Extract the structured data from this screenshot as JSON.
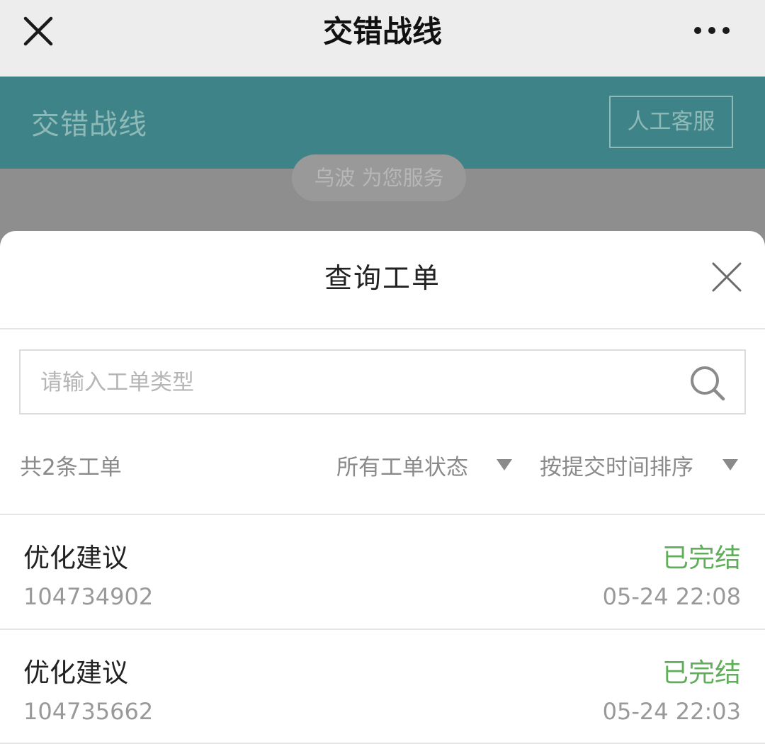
{
  "topbar": {
    "title": "交错战线",
    "close_icon": "close-icon",
    "more_icon": "more-dots-icon"
  },
  "header": {
    "brand": "交错战线",
    "human_service_label": "人工客服",
    "accent_color": "#3e8388"
  },
  "chat": {
    "serving_notice": "乌波 为您服务"
  },
  "sheet": {
    "title": "查询工单",
    "close_icon": "close-icon",
    "search": {
      "placeholder": "请输入工单类型",
      "value": "",
      "icon": "search-icon"
    },
    "filters": {
      "count_label": "共2条工单",
      "status_label": "所有工单状态",
      "sort_label": "按提交时间排序"
    },
    "tickets": [
      {
        "type": "优化建议",
        "status": "已完结",
        "id": "104734902",
        "time": "05-24 22:08"
      },
      {
        "type": "优化建议",
        "status": "已完结",
        "id": "104735662",
        "time": "05-24 22:03"
      }
    ],
    "status_color": "#5fae59"
  }
}
